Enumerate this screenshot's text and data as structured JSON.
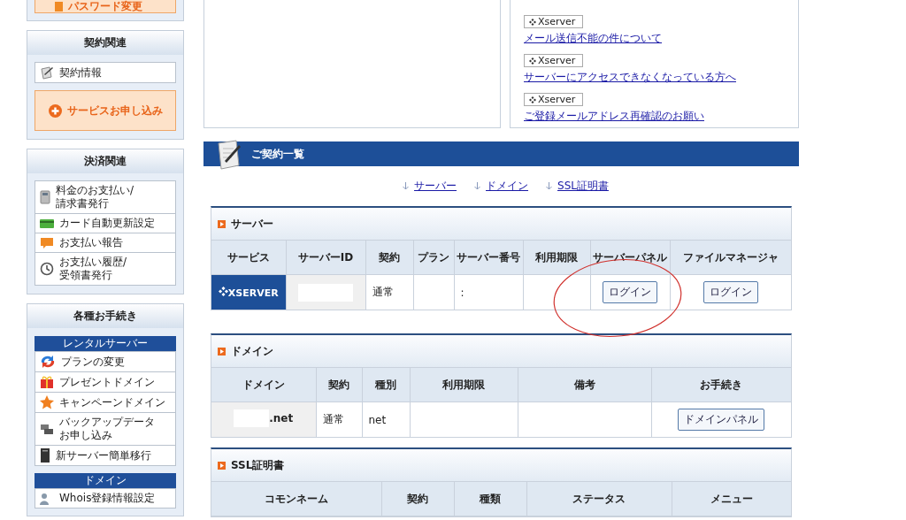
{
  "sidebar": {
    "top_button": {
      "label": "パスワード変更"
    },
    "sections": [
      {
        "title": "契約関連",
        "groups": [
          {
            "items": [
              {
                "kind": "link",
                "lines": [
                  "契約情報"
                ]
              },
              {
                "kind": "highlight",
                "lines": [
                  "サービスお申し込み"
                ]
              }
            ]
          }
        ]
      },
      {
        "title": "決済関連",
        "groups": [
          {
            "items": [
              {
                "kind": "link",
                "lines": [
                  "料金のお支払い/",
                  "請求書発行"
                ]
              },
              {
                "kind": "link",
                "lines": [
                  "カード自動更新設定"
                ]
              },
              {
                "kind": "link",
                "lines": [
                  "お支払い報告"
                ]
              },
              {
                "kind": "link",
                "lines": [
                  "お支払い履歴/",
                  "受領書発行"
                ]
              }
            ]
          }
        ]
      },
      {
        "title": "各種お手続き",
        "groups": [
          {
            "title": "レンタルサーバー",
            "items": [
              {
                "kind": "link",
                "lines": [
                  "プランの変更"
                ]
              },
              {
                "kind": "link",
                "lines": [
                  "プレゼントドメイン"
                ]
              },
              {
                "kind": "link",
                "lines": [
                  "キャンペーンドメイン"
                ]
              },
              {
                "kind": "link",
                "lines": [
                  "バックアップデータ",
                  "お申し込み"
                ]
              },
              {
                "kind": "link",
                "lines": [
                  "新サーバー簡単移行"
                ]
              }
            ]
          },
          {
            "title": "ドメイン",
            "items": [
              {
                "kind": "link",
                "lines": [
                  "Whois登録情報設定"
                ]
              }
            ]
          }
        ]
      }
    ]
  },
  "news": [
    {
      "tag": "Xserver",
      "title": "メール送信不能の件について"
    },
    {
      "tag": "Xserver",
      "title": "サーバーにアクセスできなくなっている方へ"
    },
    {
      "tag": "Xserver",
      "title": "ご登録メールアドレス再確認のお願い"
    }
  ],
  "contracts": {
    "title": "ご契約一覧",
    "anchors": [
      "サーバー",
      "ドメイン",
      "SSL証明書"
    ],
    "sections": [
      {
        "title": "サーバー",
        "columns": [
          "サービス",
          "サーバーID",
          "契約",
          "プラン",
          "サーバー番号",
          "利用期限",
          "サーバーパネル",
          "ファイルマネージャ"
        ],
        "rows": [
          [
            {
              "kind": "logo",
              "text": "XSERVER"
            },
            {
              "kind": "redacted"
            },
            {
              "kind": "text",
              "text": "通常"
            },
            {
              "kind": "empty"
            },
            {
              "kind": "text",
              "text": ":"
            },
            {
              "kind": "empty"
            },
            {
              "kind": "button",
              "text": "ログイン"
            },
            {
              "kind": "button",
              "text": "ログイン"
            }
          ]
        ],
        "annotations": [
          {
            "kind": "ellipse",
            "color": "#d0302c"
          }
        ]
      },
      {
        "title": "ドメイン",
        "columns": [
          "ドメイン",
          "契約",
          "種別",
          "利用期限",
          "備考",
          "お手続き"
        ],
        "rows": [
          [
            {
              "kind": "redacted-text",
              "text": ".net"
            },
            {
              "kind": "text",
              "text": "通常"
            },
            {
              "kind": "text",
              "text": "net"
            },
            {
              "kind": "empty"
            },
            {
              "kind": "empty"
            },
            {
              "kind": "button",
              "text": "ドメインパネル"
            }
          ]
        ]
      },
      {
        "title": "SSL証明書",
        "columns": [
          "コモンネーム",
          "契約",
          "種類",
          "ステータス",
          "メニュー"
        ]
      }
    ]
  }
}
